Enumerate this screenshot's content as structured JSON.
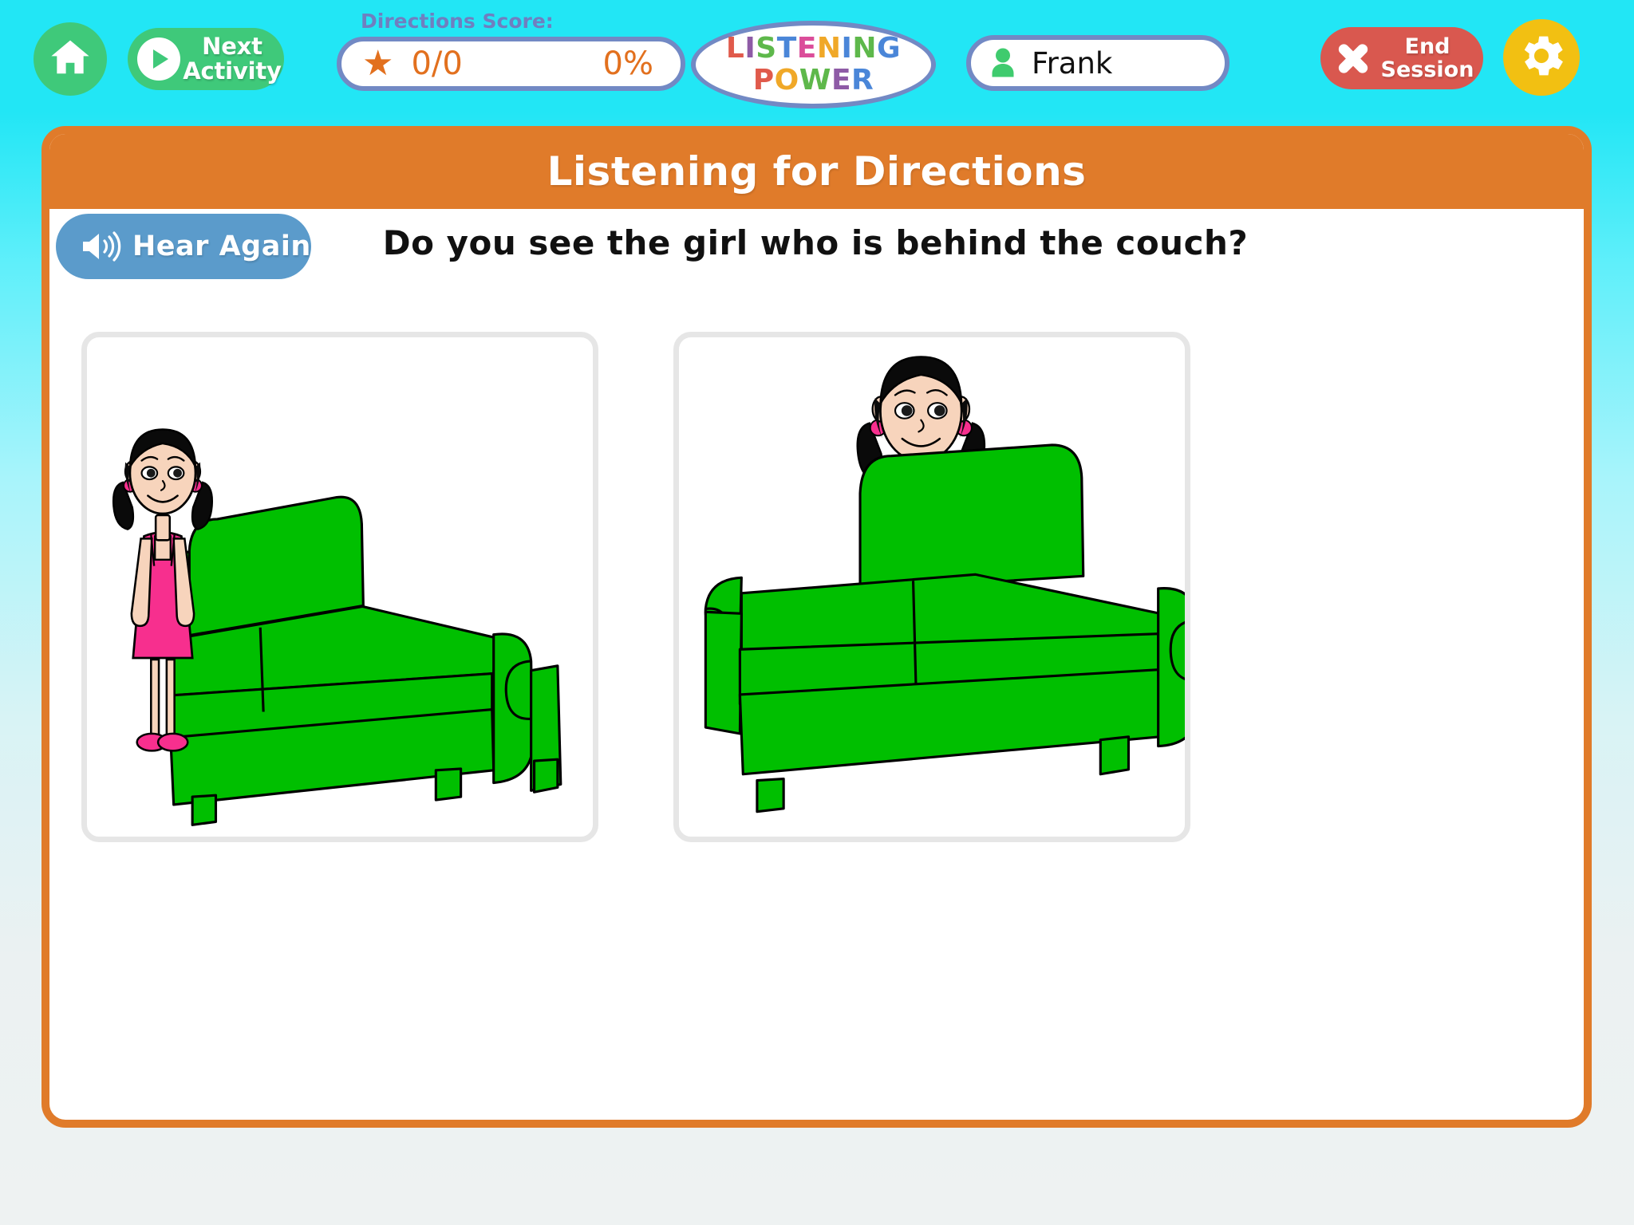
{
  "topbar": {
    "home_label": "Home",
    "next_activity_label_line1": "Next",
    "next_activity_label_line2": "Activity",
    "score_caption": "Directions Score:",
    "score_fraction": "0/0",
    "score_percent": "0%",
    "logo_line1": "LISTENING",
    "logo_line2": "POWER",
    "logo_line1_letters": [
      {
        "ch": "L",
        "color": "#E05A4B"
      },
      {
        "ch": "I",
        "color": "#8E5BA6"
      },
      {
        "ch": "S",
        "color": "#5EB84B"
      },
      {
        "ch": "T",
        "color": "#4A86D8"
      },
      {
        "ch": "E",
        "color": "#DB4D9A"
      },
      {
        "ch": "N",
        "color": "#F0A828"
      },
      {
        "ch": "I",
        "color": "#4A86D8"
      },
      {
        "ch": "N",
        "color": "#5EB84B"
      },
      {
        "ch": "G",
        "color": "#4A86D8"
      }
    ],
    "logo_line2_letters": [
      {
        "ch": "P",
        "color": "#E05A4B"
      },
      {
        "ch": "O",
        "color": "#F0A828"
      },
      {
        "ch": "W",
        "color": "#5EB84B"
      },
      {
        "ch": "E",
        "color": "#8E5BA6"
      },
      {
        "ch": "R",
        "color": "#4A86D8"
      }
    ],
    "user_name": "Frank",
    "end_session_line1": "End",
    "end_session_line2": "Session",
    "settings_label": "Settings"
  },
  "panel": {
    "title": "Listening for Directions",
    "hear_again_label": "Hear Again",
    "question": "Do you see the girl who is behind the couch?"
  },
  "choices": [
    {
      "id": "choice-left",
      "description": "Girl standing beside the couch",
      "girl_position": "beside",
      "selected": false
    },
    {
      "id": "choice-right",
      "description": "Girl standing behind the couch",
      "girl_position": "behind",
      "selected": false
    }
  ],
  "colors": {
    "background_top": "#22E6F5",
    "panel_border": "#E07B2A",
    "title_bar": "#E07B2A",
    "hear_again": "#5B9BCB",
    "green_button": "#3FC97A",
    "end_session": "#D9584F",
    "gear": "#F2C012",
    "pill_border": "#7289C4",
    "score_text": "#E2701E",
    "score_caption": "#6F7FC0",
    "couch_green": "#00BF00",
    "dress_pink": "#F72F8E",
    "skin": "#F7D4BC",
    "hair": "#0A0A0A",
    "card_border": "#E6E6E6"
  }
}
